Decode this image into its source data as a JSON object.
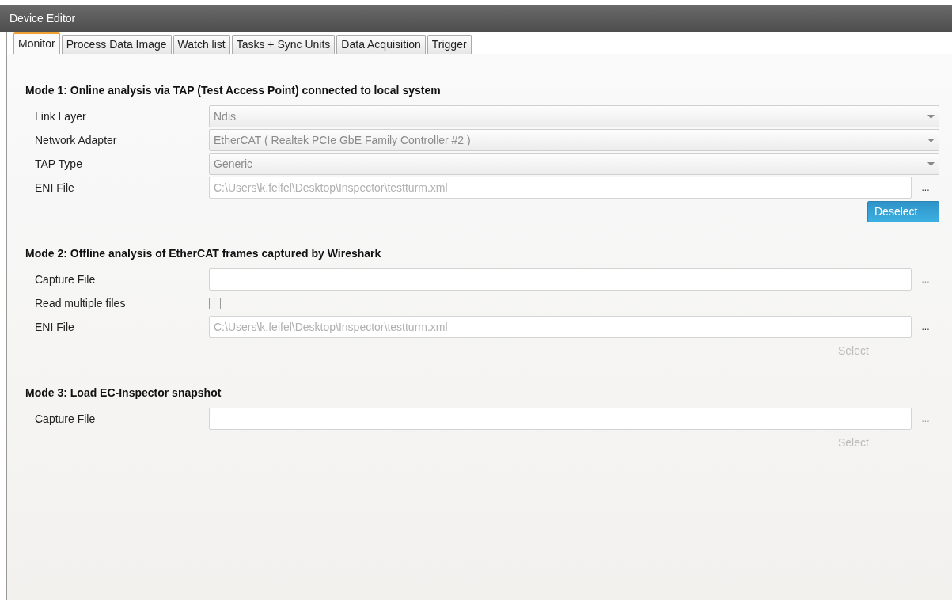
{
  "window": {
    "title": "Device Editor"
  },
  "tabs": [
    {
      "label": "Monitor",
      "selected": true
    },
    {
      "label": "Process Data Image",
      "selected": false
    },
    {
      "label": "Watch list",
      "selected": false
    },
    {
      "label": "Tasks + Sync Units",
      "selected": false
    },
    {
      "label": "Data Acquisition",
      "selected": false
    },
    {
      "label": "Trigger",
      "selected": false
    }
  ],
  "sections": [
    {
      "heading": "Mode 1: Online analysis via TAP (Test Access Point) connected to local system",
      "rows": [
        {
          "kind": "dropdown",
          "label": "Link Layer",
          "value": "Ndis",
          "disabled": true
        },
        {
          "kind": "dropdown",
          "label": "Network Adapter",
          "value": "EtherCAT ( Realtek PCIe GbE Family Controller #2 )",
          "disabled": true
        },
        {
          "kind": "dropdown",
          "label": "TAP Type",
          "value": "Generic",
          "disabled": true
        },
        {
          "kind": "file",
          "label": "ENI File",
          "value": "C:\\Users\\k.feifel\\Desktop\\Inspector\\testturm.xml",
          "browse": "...",
          "browse_enabled": true
        }
      ],
      "action": {
        "label": "Deselect",
        "enabled": true
      }
    },
    {
      "heading": "Mode 2: Offline analysis of EtherCAT frames captured by Wireshark",
      "rows": [
        {
          "kind": "file",
          "label": "Capture File",
          "browse": "...",
          "browse_enabled": false
        },
        {
          "kind": "checkbox",
          "label": "Read multiple files",
          "checked": false
        },
        {
          "kind": "file",
          "label": "ENI File",
          "value": "C:\\Users\\k.feifel\\Desktop\\Inspector\\testturm.xml",
          "browse": "...",
          "browse_enabled": true
        }
      ],
      "action": {
        "label": "Select",
        "enabled": false
      }
    },
    {
      "heading": "Mode 3: Load EC-Inspector snapshot",
      "rows": [
        {
          "kind": "file",
          "label": "Capture File",
          "browse": "...",
          "browse_enabled": false
        }
      ],
      "action": {
        "label": "Select",
        "enabled": false
      }
    }
  ]
}
